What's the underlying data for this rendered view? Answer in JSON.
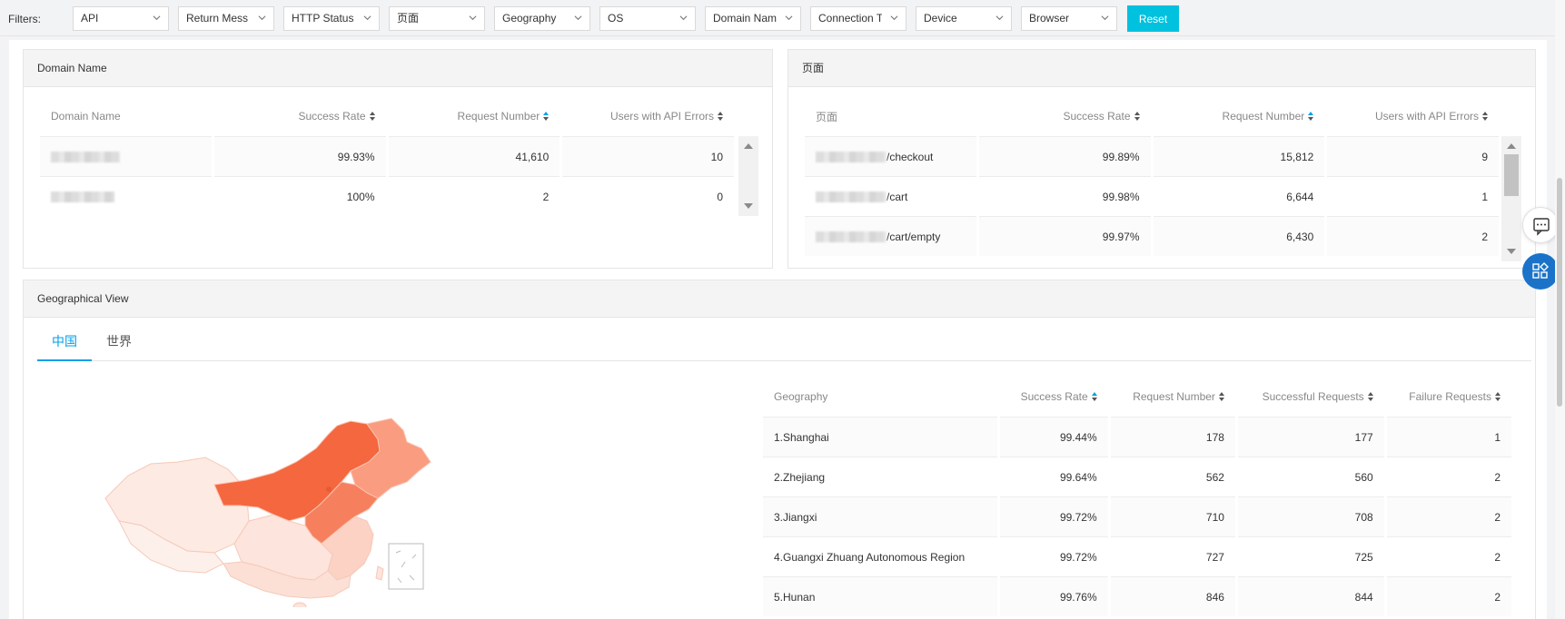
{
  "filters": {
    "label": "Filters:",
    "dropdowns": [
      {
        "label": "API"
      },
      {
        "label": "Return Mess"
      },
      {
        "label": "HTTP Status"
      },
      {
        "label": "页面"
      },
      {
        "label": "Geography"
      },
      {
        "label": "OS"
      },
      {
        "label": "Domain Nam"
      },
      {
        "label": "Connection T"
      },
      {
        "label": "Device"
      },
      {
        "label": "Browser"
      }
    ],
    "reset_label": "Reset"
  },
  "domain_panel": {
    "title": "Domain Name",
    "columns": [
      "Domain Name",
      "Success Rate",
      "Request Number",
      "Users with API Errors"
    ],
    "rows": [
      {
        "name": "",
        "success_rate": "99.93%",
        "requests": "41,610",
        "users_err": "10"
      },
      {
        "name": "",
        "success_rate": "100%",
        "requests": "2",
        "users_err": "0"
      }
    ]
  },
  "page_panel": {
    "title": "页面",
    "columns": [
      "页面",
      "Success Rate",
      "Request Number",
      "Users with API Errors"
    ],
    "rows": [
      {
        "path": "/checkout",
        "success_rate": "99.89%",
        "requests": "15,812",
        "users_err": "9"
      },
      {
        "path": "/cart",
        "success_rate": "99.98%",
        "requests": "6,644",
        "users_err": "1"
      },
      {
        "path": "/cart/empty",
        "success_rate": "99.97%",
        "requests": "6,430",
        "users_err": "2"
      }
    ]
  },
  "geo_panel": {
    "title": "Geographical View",
    "tabs": [
      {
        "label": "中国",
        "active": true
      },
      {
        "label": "世界",
        "active": false
      }
    ],
    "map_colors": {
      "high": "#f4673f",
      "mid": "#f99c80",
      "low": "#fde4dc",
      "base": "#fdf0eb"
    },
    "columns": [
      "Geography",
      "Success Rate",
      "Request Number",
      "Successful Requests",
      "Failure Requests"
    ],
    "rows": [
      {
        "geo": "1.Shanghai",
        "success_rate": "99.44%",
        "requests": "178",
        "successful": "177",
        "failed": "1"
      },
      {
        "geo": "2.Zhejiang",
        "success_rate": "99.64%",
        "requests": "562",
        "successful": "560",
        "failed": "2"
      },
      {
        "geo": "3.Jiangxi",
        "success_rate": "99.72%",
        "requests": "710",
        "successful": "708",
        "failed": "2"
      },
      {
        "geo": "4.Guangxi Zhuang Autonomous Region",
        "success_rate": "99.72%",
        "requests": "727",
        "successful": "725",
        "failed": "2"
      },
      {
        "geo": "5.Hunan",
        "success_rate": "99.76%",
        "requests": "846",
        "successful": "844",
        "failed": "2"
      }
    ]
  },
  "side_buttons": [
    {
      "icon": "comment-icon"
    },
    {
      "icon": "apps-icon"
    }
  ]
}
